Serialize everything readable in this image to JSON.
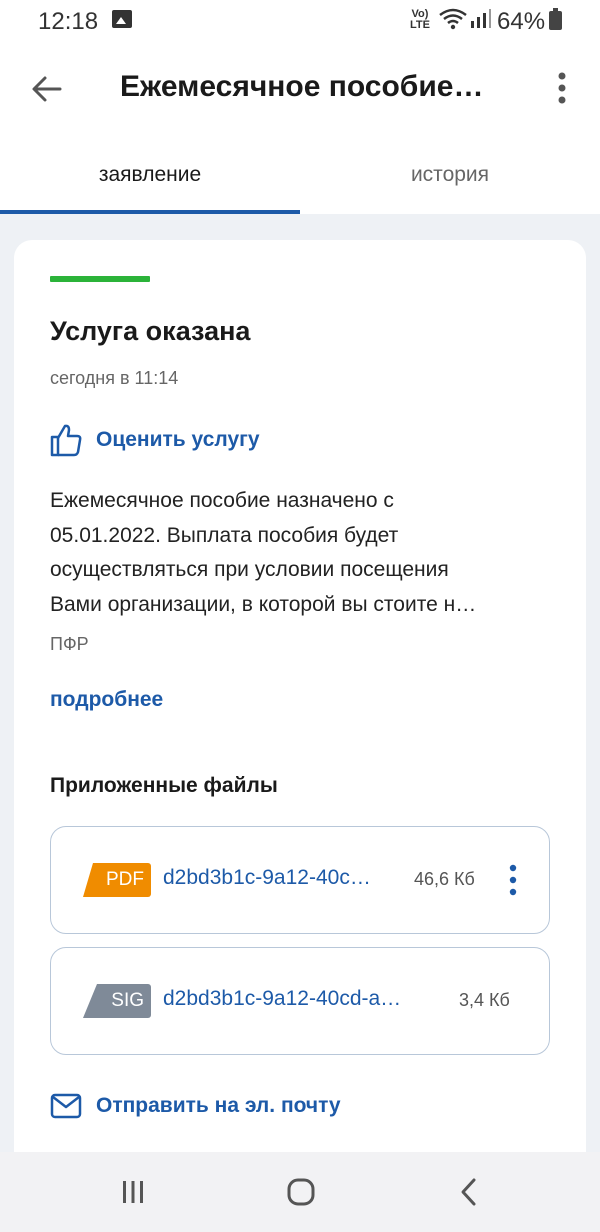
{
  "status_bar": {
    "time": "12:18",
    "volte_top": "Vo)",
    "volte_bottom": "LTE",
    "battery": "64%"
  },
  "header": {
    "title": "Ежемесячное пособие…"
  },
  "tabs": [
    {
      "label": "заявление",
      "active": true
    },
    {
      "label": "история",
      "active": false
    }
  ],
  "card": {
    "status_color": "#2bb339",
    "title": "Услуга оказана",
    "date": "сегодня в 11:14",
    "rate_label": "Оценить услугу",
    "description_lines": [
      "Ежемесячное пособие назначено с",
      "05.01.2022. Выплата пособия будет",
      "осуществляться при условии посещения",
      "Вами организации, в которой вы стоите н…"
    ],
    "organization": "ПФР",
    "more_link": "подробнее",
    "files_title": "Приложенные файлы",
    "files": [
      {
        "type": "PDF",
        "name": "d2bd3b1c-9a12-40c…",
        "size": "46,6 Кб"
      },
      {
        "type": "SIG",
        "name": "d2bd3b1c-9a12-40cd-a…",
        "size": "3,4 Кб"
      }
    ],
    "send_label": "Отправить на эл. почту"
  },
  "colors": {
    "accent": "#1d5aa8",
    "pdf": "#f08c00",
    "sig": "#7f8a98"
  }
}
